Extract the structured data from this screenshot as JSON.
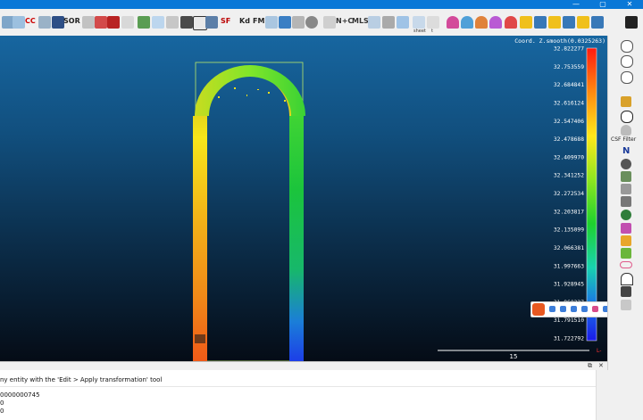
{
  "window": {
    "controls": {
      "minimize": "—",
      "maximize": "▢",
      "close": "✕"
    }
  },
  "toolbar": {
    "labels": {
      "cc": "CC",
      "sor": "SOR",
      "sf": "SF",
      "kd": "Kd",
      "fm": "FM",
      "nc": "N+C",
      "mls": "MLS",
      "sheet": "sheet",
      "t": "t"
    }
  },
  "viewport": {
    "scalar_title": "Coord. Z.smooth(0.0325263)",
    "scalar_ticks": [
      "32.822277",
      "32.753559",
      "32.684841",
      "32.616124",
      "32.547406",
      "32.478688",
      "32.409970",
      "32.341252",
      "32.272534",
      "32.203817",
      "32.135099",
      "32.066381",
      "31.997663",
      "31.928945",
      "31.860227",
      "31.791510",
      "31.722792"
    ],
    "scale_bar_label": "15",
    "axis_label": "L-",
    "colors": {
      "bg_top": "#1766a0",
      "bg_bottom": "#050c16"
    }
  },
  "sidebar": {
    "csf_label": "CSF Filter",
    "north_label": "N"
  },
  "console": {
    "header_buttons": {
      "float": "⧉",
      "close": "✕"
    },
    "lines": [
      "ny entity with the 'Edit > Apply transformation' tool",
      "0000000745",
      "0",
      "0"
    ]
  }
}
